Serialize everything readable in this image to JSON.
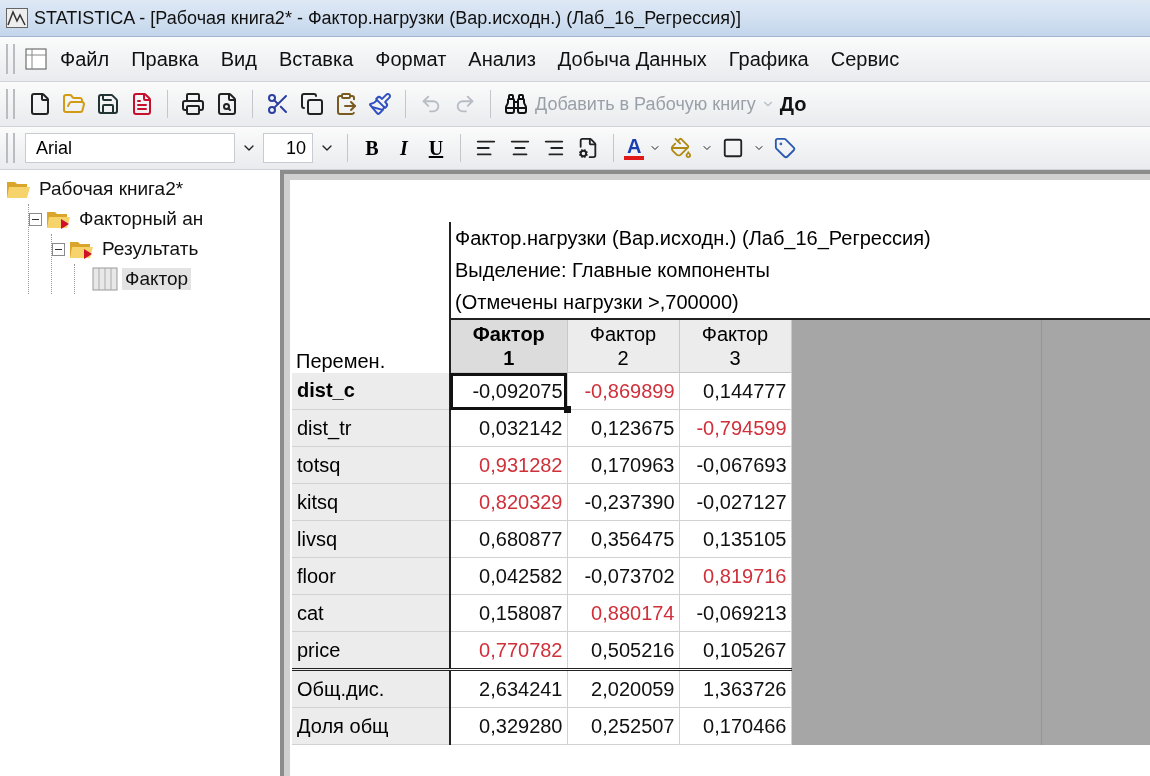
{
  "window": {
    "title": "STATISTICA - [Рабочая книга2* - Фактор.нагрузки (Вар.исходн.) (Лаб_16_Регрессия)]"
  },
  "menu": [
    "Файл",
    "Правка",
    "Вид",
    "Вставка",
    "Формат",
    "Анализ",
    "Добыча Данных",
    "Графика",
    "Сервис"
  ],
  "toolbar": {
    "add_to_workbook": "Добавить в Рабочую книгу",
    "cut_label": "До"
  },
  "format_toolbar": {
    "font": "Arial",
    "size": "10",
    "bold": "B",
    "italic": "I",
    "underline": "U",
    "font_color": "A"
  },
  "tree": [
    {
      "label": "Рабочая книга2*",
      "kind": "folder",
      "expanded": true,
      "selected": false,
      "children": [
        {
          "label": "Факторный ан",
          "kind": "analysis",
          "expanded": true,
          "selected": false,
          "children": [
            {
              "label": "Результать",
              "kind": "analysis",
              "expanded": true,
              "selected": false,
              "children": [
                {
                  "label": "Фактор",
                  "kind": "sheet",
                  "selected": true
                }
              ]
            }
          ]
        }
      ]
    }
  ],
  "spreadsheet": {
    "title_lines": [
      "Фактор.нагрузки (Вар.исходн.) (Лаб_16_Регрессия)",
      "Выделение: Главные компоненты",
      "(Отмечены нагрузки >,700000)"
    ],
    "row_header_label": "Перемен.",
    "columns": [
      {
        "line1": "Фактор",
        "line2": "1",
        "selected": true
      },
      {
        "line1": "Фактор",
        "line2": "2",
        "selected": false
      },
      {
        "line1": "Фактор",
        "line2": "3",
        "selected": false
      }
    ],
    "rows": [
      {
        "name": "dist_c",
        "selected": true,
        "cells": [
          {
            "value": "-0,092075",
            "marked": false,
            "selected": true
          },
          {
            "value": "-0,869899",
            "marked": true,
            "selected": false
          },
          {
            "value": "0,144777",
            "marked": false,
            "selected": false
          }
        ]
      },
      {
        "name": "dist_tr",
        "selected": false,
        "cells": [
          {
            "value": "0,032142",
            "marked": false,
            "selected": false
          },
          {
            "value": "0,123675",
            "marked": false,
            "selected": false
          },
          {
            "value": "-0,794599",
            "marked": true,
            "selected": false
          }
        ]
      },
      {
        "name": "totsq",
        "selected": false,
        "cells": [
          {
            "value": "0,931282",
            "marked": true,
            "selected": false
          },
          {
            "value": "0,170963",
            "marked": false,
            "selected": false
          },
          {
            "value": "-0,067693",
            "marked": false,
            "selected": false
          }
        ]
      },
      {
        "name": "kitsq",
        "selected": false,
        "cells": [
          {
            "value": "0,820329",
            "marked": true,
            "selected": false
          },
          {
            "value": "-0,237390",
            "marked": false,
            "selected": false
          },
          {
            "value": "-0,027127",
            "marked": false,
            "selected": false
          }
        ]
      },
      {
        "name": "livsq",
        "selected": false,
        "cells": [
          {
            "value": "0,680877",
            "marked": false,
            "selected": false
          },
          {
            "value": "0,356475",
            "marked": false,
            "selected": false
          },
          {
            "value": "0,135105",
            "marked": false,
            "selected": false
          }
        ]
      },
      {
        "name": "floor",
        "selected": false,
        "cells": [
          {
            "value": "0,042582",
            "marked": false,
            "selected": false
          },
          {
            "value": "-0,073702",
            "marked": false,
            "selected": false
          },
          {
            "value": "0,819716",
            "marked": true,
            "selected": false
          }
        ]
      },
      {
        "name": "cat",
        "selected": false,
        "cells": [
          {
            "value": "0,158087",
            "marked": false,
            "selected": false
          },
          {
            "value": "0,880174",
            "marked": true,
            "selected": false
          },
          {
            "value": "-0,069213",
            "marked": false,
            "selected": false
          }
        ]
      },
      {
        "name": "price",
        "selected": false,
        "cells": [
          {
            "value": "0,770782",
            "marked": true,
            "selected": false
          },
          {
            "value": "0,505216",
            "marked": false,
            "selected": false
          },
          {
            "value": "0,105267",
            "marked": false,
            "selected": false
          }
        ]
      }
    ],
    "summary_rows": [
      {
        "name": "Общ.дис.",
        "cells": [
          "2,634241",
          "2,020059",
          "1,363726"
        ]
      },
      {
        "name": "Доля общ",
        "cells": [
          "0,329280",
          "0,252507",
          "0,170466"
        ]
      }
    ]
  }
}
